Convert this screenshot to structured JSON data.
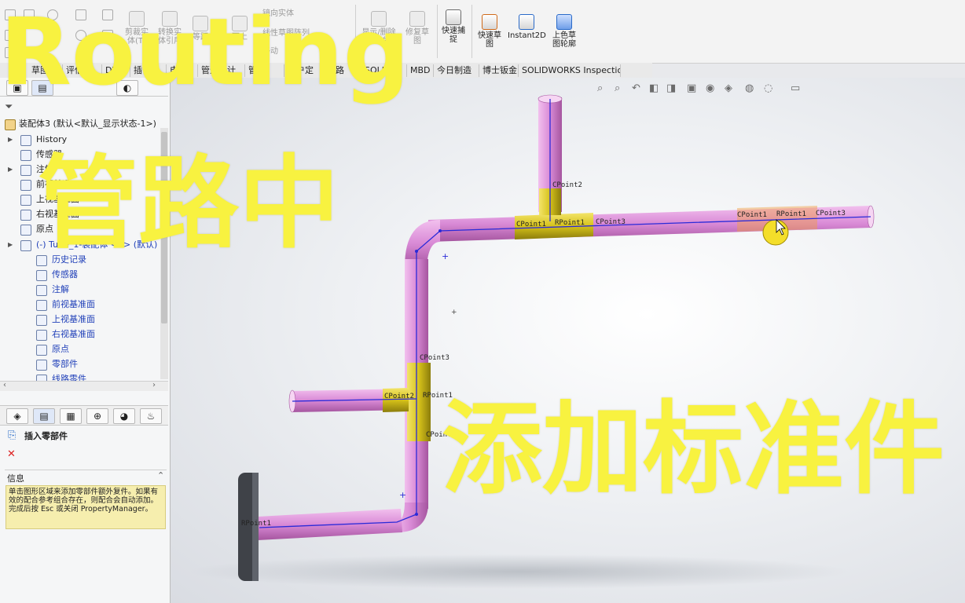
{
  "ribbon": {
    "sketch_tools": {
      "trim": "剪裁实\n体(T)",
      "convert": "转换实\n体引用",
      "offset": "等距",
      "on_surface": "面上",
      "mirror": "镜向实体",
      "linear_pattern": "线性草图阵列",
      "move": "移动",
      "display_delete": "显示/删除\n几何关系",
      "repair": "修复草\n图",
      "quick_snap": "快速捕\n捉",
      "rapid_sketch": "快速草\n图",
      "instant2d": "Instant2D",
      "shaded_sketch": "上色草\n图轮廓"
    }
  },
  "tabs": [
    "草图",
    "评估",
    "DW",
    "插件",
    "电气",
    "管道设计",
    "管筒",
    "用户定",
    "线路",
    "SOLIDW",
    "MBD",
    "今日制造",
    "博士钣金",
    "SOLIDWORKS Inspection"
  ],
  "tree": {
    "root": "装配体3 (默认<默认_显示状态-1>)",
    "items": [
      {
        "label": "History",
        "color": "#222222"
      },
      {
        "label": "传感器",
        "color": "#222222"
      },
      {
        "label": "注解",
        "color": "#222222"
      },
      {
        "label": "前视基准面",
        "color": "#222222"
      },
      {
        "label": "上视基准面",
        "color": "#222222"
      },
      {
        "label": "右视基准面",
        "color": "#222222"
      },
      {
        "label": "原点",
        "color": "#222222"
      },
      {
        "label": "(-) Tube_1-装配体 <1> (默认)",
        "color": "#1f3fb8"
      }
    ],
    "sub_items": [
      "历史记录",
      "传感器",
      "注解",
      "前视基准面",
      "上视基准面",
      "右视基准面",
      "原点",
      "零部件",
      "线路零件"
    ]
  },
  "property_manager": {
    "title": "插入零部件",
    "close_symbol": "✕",
    "info_header": "信息",
    "info_text": "单击图形区域来添加零部件额外复件。如果有效的配合参考组合存在，则配合会自动添加。完成后按 Esc 或关闭 PropertyManager。"
  },
  "viewport": {
    "labels": [
      "CPoint2",
      "CPoint1",
      "RPoint1",
      "CPoint3",
      "CPoint1",
      "RPoint1",
      "CPoint3",
      "CPoint3",
      "CPoint2",
      "RPoint1",
      "CPoint1",
      "RPoint1"
    ],
    "pipe_color": "#d98ad6",
    "fitting_color": "#d6c21a",
    "route_color": "#2a2ad8"
  },
  "overlay": {
    "title_en": "Routing",
    "title_cn": "管路中",
    "subtitle_cn": "添加标准件",
    "color": "#f8f240"
  }
}
